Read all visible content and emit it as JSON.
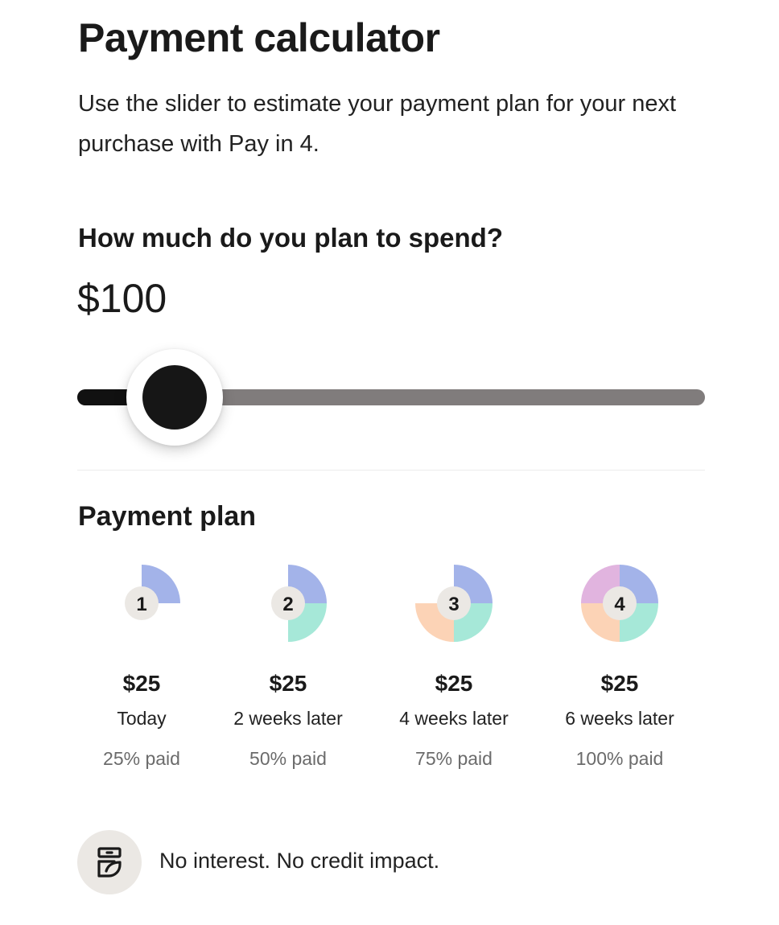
{
  "header": {
    "title": "Payment calculator",
    "intro": "Use the slider to estimate your payment plan for your next purchase with Pay in 4."
  },
  "calculator": {
    "question": "How much do you plan to spend?",
    "amount": "$100",
    "slider_fraction": 0.155
  },
  "plan": {
    "title": "Payment plan",
    "installments": [
      {
        "number": "1",
        "amount": "$25",
        "when": "Today",
        "paid": "25% paid",
        "quarters_filled": 1
      },
      {
        "number": "2",
        "amount": "$25",
        "when": "2 weeks later",
        "paid": "50% paid",
        "quarters_filled": 2
      },
      {
        "number": "3",
        "amount": "$25",
        "when": "4 weeks later",
        "paid": "75% paid",
        "quarters_filled": 3
      },
      {
        "number": "4",
        "amount": "$25",
        "when": "6 weeks later",
        "paid": "100% paid",
        "quarters_filled": 4
      }
    ],
    "quarter_colors": [
      "#a3b3e9",
      "#a6e8d8",
      "#fcd3b6",
      "#e1b4df"
    ],
    "badge_color": "#ebe8e4"
  },
  "footer": {
    "note": "No interest. No credit impact.",
    "icon": "no-interest-icon"
  }
}
